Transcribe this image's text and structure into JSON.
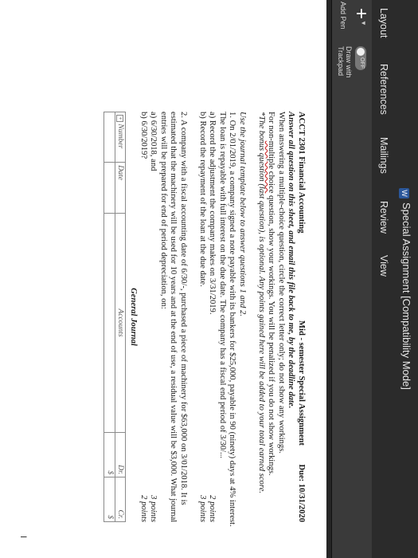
{
  "window": {
    "title": "Special Assignment [Compatibility Mode]",
    "icon": "word-doc-icon"
  },
  "ribbon_tabs": [
    {
      "label": "Layout"
    },
    {
      "label": "References"
    },
    {
      "label": "Mailings"
    },
    {
      "label": "Review"
    },
    {
      "label": "View"
    }
  ],
  "ribbon": {
    "add_pen_label": "Add Pen",
    "toggle_state": "OFF",
    "draw_with_trackpad_line1": "Draw with",
    "draw_with_trackpad_line2": "Trackpad"
  },
  "document": {
    "course": "ACCT 2301 Financial Accounting",
    "assignment": "Mid - semester Special Assignment",
    "due": "Due: 10/31/2020",
    "instr1": "Answer all question on this sheet, and email this file back to me, by the deadline date.",
    "instr2": "When answering a multiple-choice question, circle the correct letter only; do not show any workings.",
    "instr3_pre": "For non-",
    "instr3_ul": "multiple choice",
    "instr3_post": " question, show your workings. You will be penalized if you do not show workings.",
    "instr4": "*The bonus question (last question), is optional. Any points gained here will be added to your total earned score.",
    "template_note": "Use the journal template below to answer questions 1 and 2.",
    "q1_line1": "1. On 2/01/2019, a company signed a note payable with its bankers for $25,000, payable in 90 (ninety) days at 4% interest.",
    "q1_line2": "The loan is repayable with full interest on the due date. The company has a fiscal end period of 3/30/...",
    "q1a": "a) Record the adjustment the company makes on 3/31/2019.",
    "q1a_pts": "2 points",
    "q1b": "b) Record the repayment of the loan at the due date.",
    "q1b_pts": "3 points",
    "q2_line1": "2. A company with a fiscal accounting date of 6/30/-, purchased a piece of machinery for $63,000 on 3/01/2018. It is",
    "q2_line2": "estimated that the machinery will be used for 10 years and at the end of use, a residual value will be $3,000. What journal",
    "q2_line3": "entries will be prepared for end of period depreciation, on:",
    "q2a": "a) 6/30/2018, and",
    "q2a_pts": "3 points",
    "q2b": "b) 6/30/2019?",
    "q2b_pts": "2 points",
    "journal_title": "General Journal",
    "journal_headers": [
      "Number",
      "Date",
      "Accounts",
      "Dr.",
      "Cr."
    ],
    "journal_row1": [
      "",
      "",
      "",
      "$",
      "$"
    ],
    "move_handle": "+"
  },
  "cursor_glyph": "I"
}
